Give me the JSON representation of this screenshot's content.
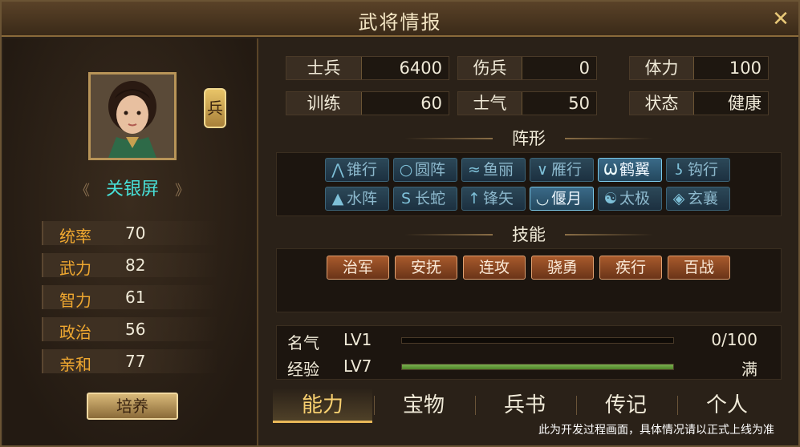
{
  "window": {
    "title": "武将情报",
    "close_icon": "close-icon"
  },
  "general": {
    "name": "关银屏",
    "badge": "兵",
    "stats": [
      {
        "label": "统率",
        "value": "70"
      },
      {
        "label": "武力",
        "value": "82"
      },
      {
        "label": "智力",
        "value": "61"
      },
      {
        "label": "政治",
        "value": "56"
      },
      {
        "label": "亲和",
        "value": "77"
      }
    ],
    "train_button": "培养"
  },
  "troops": [
    {
      "label": "士兵",
      "value": "6400"
    },
    {
      "label": "伤兵",
      "value": "0"
    },
    {
      "label": "体力",
      "value": "100"
    },
    {
      "label": "训练",
      "value": "60"
    },
    {
      "label": "士气",
      "value": "50"
    },
    {
      "label": "状态",
      "value": "健康"
    }
  ],
  "formation": {
    "title": "阵形",
    "items": [
      {
        "label": "锥行",
        "icon": "arrow-up-icon",
        "active": false
      },
      {
        "label": "圆阵",
        "icon": "circle-icon",
        "active": false
      },
      {
        "label": "鱼丽",
        "icon": "fish-icon",
        "active": false
      },
      {
        "label": "雁行",
        "icon": "v-shape-icon",
        "active": false
      },
      {
        "label": "鹤翼",
        "icon": "wing-icon",
        "active": true
      },
      {
        "label": "钩行",
        "icon": "hook-icon",
        "active": false
      },
      {
        "label": "水阵",
        "icon": "wave-icon",
        "active": false
      },
      {
        "label": "长蛇",
        "icon": "snake-icon",
        "active": false
      },
      {
        "label": "锋矢",
        "icon": "arrow-icon",
        "active": false
      },
      {
        "label": "偃月",
        "icon": "crescent-icon",
        "active": true
      },
      {
        "label": "太极",
        "icon": "taiji-icon",
        "active": false
      },
      {
        "label": "玄襄",
        "icon": "diamond-icon",
        "active": false
      }
    ]
  },
  "skills": {
    "title": "技能",
    "items": [
      "治军",
      "安抚",
      "连攻",
      "骁勇",
      "疾行",
      "百战"
    ]
  },
  "levels": [
    {
      "label": "名气",
      "lv": "LV1",
      "progress": 0.0,
      "value": "0/100"
    },
    {
      "label": "经验",
      "lv": "LV7",
      "progress": 1.0,
      "value": "满"
    }
  ],
  "tabs": [
    {
      "label": "能力",
      "active": true
    },
    {
      "label": "宝物",
      "active": false
    },
    {
      "label": "兵书",
      "active": false
    },
    {
      "label": "传记",
      "active": false
    },
    {
      "label": "个人",
      "active": false
    }
  ],
  "notice": "此为开发过程画面，具体情况请以正式上线为准"
}
